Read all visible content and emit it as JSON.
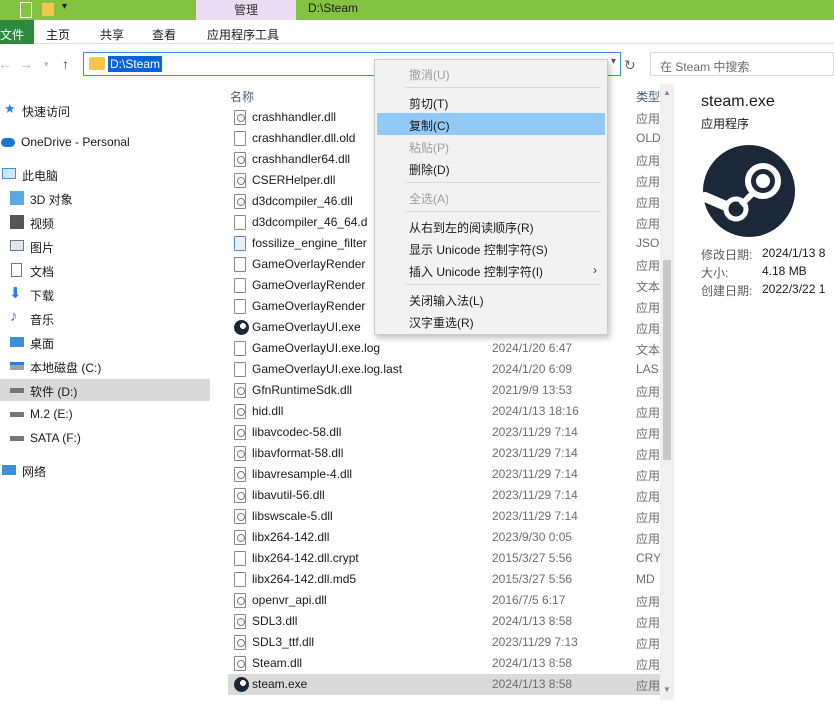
{
  "window": {
    "title": "D:\\Steam",
    "manage_tab": "管理"
  },
  "ribbon": {
    "file": "文件",
    "home": "主页",
    "share": "共享",
    "view": "查看",
    "app_tools": "应用程序工具"
  },
  "address": {
    "path": "D:\\Steam",
    "search_placeholder": "在 Steam 中搜索"
  },
  "nav": {
    "quick_access": "快速访问",
    "onedrive": "OneDrive - Personal",
    "this_pc": "此电脑",
    "objects3d": "3D 对象",
    "videos": "视频",
    "pictures": "图片",
    "documents": "文档",
    "downloads": "下载",
    "music": "音乐",
    "desktop": "桌面",
    "drive_c": "本地磁盘 (C:)",
    "drive_d": "软件 (D:)",
    "drive_e": "M.2 (E:)",
    "drive_f": "SATA (F:)",
    "network": "网络"
  },
  "columns": {
    "name": "名称",
    "type": "类型"
  },
  "files": [
    {
      "name": "crashhandler.dll",
      "date": "",
      "type": "应用"
    },
    {
      "name": "crashhandler.dll.old",
      "date": "",
      "type": "OLD"
    },
    {
      "name": "crashhandler64.dll",
      "date": "",
      "type": "应用"
    },
    {
      "name": "CSERHelper.dll",
      "date": "",
      "type": "应用"
    },
    {
      "name": "d3dcompiler_46.dll",
      "date": "",
      "type": "应用"
    },
    {
      "name": "d3dcompiler_46_64.d",
      "date": "",
      "type": "应用"
    },
    {
      "name": "fossilize_engine_filter",
      "date": "",
      "type": "JSO"
    },
    {
      "name": "GameOverlayRender",
      "date": "",
      "type": "应用"
    },
    {
      "name": "GameOverlayRender",
      "date": "",
      "type": "文本"
    },
    {
      "name": "GameOverlayRender",
      "date": "",
      "type": "应用"
    },
    {
      "name": "GameOverlayUI.exe",
      "date": "",
      "type": "应用"
    },
    {
      "name": "GameOverlayUI.exe.log",
      "date": "2024/1/20 6:47",
      "type": "文本"
    },
    {
      "name": "GameOverlayUI.exe.log.last",
      "date": "2024/1/20 6:09",
      "type": "LAS"
    },
    {
      "name": "GfnRuntimeSdk.dll",
      "date": "2021/9/9 13:53",
      "type": "应用"
    },
    {
      "name": "hid.dll",
      "date": "2024/1/13 18:16",
      "type": "应用"
    },
    {
      "name": "libavcodec-58.dll",
      "date": "2023/11/29 7:14",
      "type": "应用"
    },
    {
      "name": "libavformat-58.dll",
      "date": "2023/11/29 7:14",
      "type": "应用"
    },
    {
      "name": "libavresample-4.dll",
      "date": "2023/11/29 7:14",
      "type": "应用"
    },
    {
      "name": "libavutil-56.dll",
      "date": "2023/11/29 7:14",
      "type": "应用"
    },
    {
      "name": "libswscale-5.dll",
      "date": "2023/11/29 7:14",
      "type": "应用"
    },
    {
      "name": "libx264-142.dll",
      "date": "2023/9/30 0:05",
      "type": "应用"
    },
    {
      "name": "libx264-142.dll.crypt",
      "date": "2015/3/27 5:56",
      "type": "CRY"
    },
    {
      "name": "libx264-142.dll.md5",
      "date": "2015/3/27 5:56",
      "type": "MD"
    },
    {
      "name": "openvr_api.dll",
      "date": "2016/7/5 6:17",
      "type": "应用"
    },
    {
      "name": "SDL3.dll",
      "date": "2024/1/13 8:58",
      "type": "应用"
    },
    {
      "name": "SDL3_ttf.dll",
      "date": "2023/11/29 7:13",
      "type": "应用"
    },
    {
      "name": "Steam.dll",
      "date": "2024/1/13 8:58",
      "type": "应用"
    },
    {
      "name": "steam.exe",
      "date": "2024/1/13 8:58",
      "type": "应用"
    }
  ],
  "details": {
    "name": "steam.exe",
    "kind": "应用程序",
    "modified_label": "修改日期:",
    "modified_value": "2024/1/13 8",
    "size_label": "大小:",
    "size_value": "4.18 MB",
    "created_label": "创建日期:",
    "created_value": "2022/3/22 1"
  },
  "context_menu": {
    "undo": "撤消(U)",
    "cut": "剪切(T)",
    "copy": "复制(C)",
    "paste": "粘贴(P)",
    "delete": "删除(D)",
    "select_all": "全选(A)",
    "rtl": "从右到左的阅读顺序(R)",
    "show_unicode": "显示 Unicode 控制字符(S)",
    "insert_unicode": "插入 Unicode 控制字符(I)",
    "close_ime": "关闭输入法(L)",
    "reconversion": "汉字重选(R)",
    "submenu_arrow": "›"
  },
  "colors": {
    "title_green": "#84c341",
    "manage_purple": "#ecdcf4",
    "selection_blue": "#0a64d6",
    "menu_highlight": "#91c9f7"
  }
}
